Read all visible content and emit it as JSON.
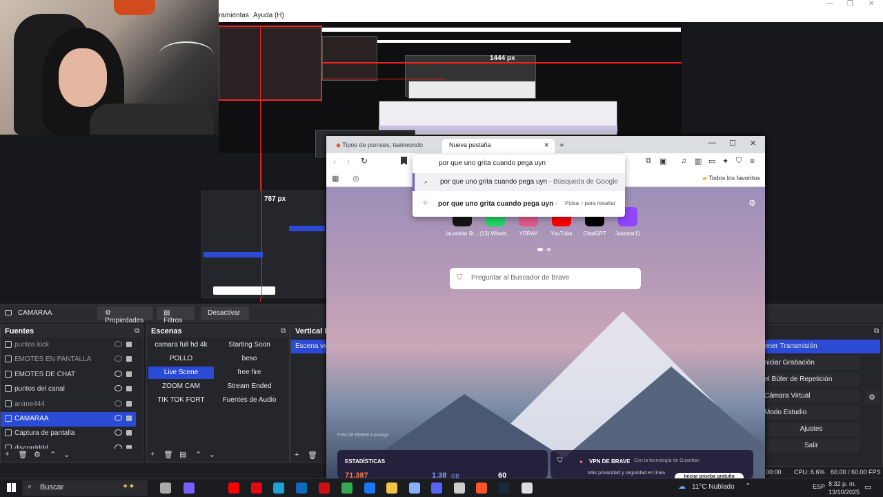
{
  "obs": {
    "menu": {
      "tools": "ramientas",
      "help": "Ayuda (H)"
    },
    "preview": {
      "label_1444": "1444 px",
      "label_787": "787 px"
    },
    "selected_source": "CAMARAA",
    "toolbar": {
      "properties": "Propiedades",
      "filters": "Filtros",
      "deactivate": "Desactivar"
    },
    "sources_title": "Fuentes",
    "sources": [
      {
        "label": "puntos kick",
        "dim": true
      },
      {
        "label": "EMOTES EN PANTALLA",
        "dim": true
      },
      {
        "label": "EMOTES DE CHAT",
        "dim": false
      },
      {
        "label": "puntos del canal",
        "dim": false
      },
      {
        "label": "anime444",
        "dim": true
      },
      {
        "label": "CAMARAA",
        "dim": false,
        "selected": true
      },
      {
        "label": "Captura de pantalla",
        "dim": false
      },
      {
        "label": "discordddd",
        "dim": false
      }
    ],
    "scenes_title": "Escenas",
    "scenes_left": [
      "camara full hd 4k",
      "POLLO",
      "Live Scene",
      "ZOOM CAM",
      "TIK TOK FORT"
    ],
    "scenes_right": [
      "Starting Soon",
      "beso",
      "free fire",
      "Stream Ended",
      "Fuentes de Audio"
    ],
    "vertical_title": "Vertical Es",
    "vertical_scene": "Escena vert",
    "controls": [
      "ener Transmisión",
      "niciar Grabación",
      "el Búfer de Repetición",
      "Cámara Virtual",
      "Modo Estudio",
      "Ajustes",
      "Salir"
    ],
    "status": {
      "time": "00:00",
      "cpu": "CPU: 6.6%",
      "fps": "60.00 / 60.00 FPS"
    }
  },
  "browser": {
    "tabs": [
      "Tipos de pumses, taekwondo",
      "Nueva pestaña"
    ],
    "omnibox_text": "por que uno grita cuando pega uyn",
    "suggestion_1": "por que uno grita cuando pega uyn",
    "suggestion_1_suffix": "- Búsqueda de Google",
    "suggestion_2": "por que uno grita cuando pega uyn",
    "suggestion_2_suffix": "-",
    "suggestion_2_hint": "Pulsa ↑ para resaltar",
    "bookmarks_folder": "Todos los favoritos",
    "tiles": [
      "lauratula St...",
      "(13) Whats...",
      "YDRAY",
      "YouTube",
      "ChatGPT",
      "Justmar11"
    ],
    "search_placeholder": "Preguntar al Buscador de Brave",
    "photo_credit": "Foto de Matein Lowaigo",
    "stats": {
      "title": "ESTADÍSTICAS",
      "value1": "71.387",
      "value2": "1.38",
      "unit2": "GB",
      "value3": "60"
    },
    "vpn": {
      "title": "VPN DE BRAVE",
      "powered": "Con la tecnología de Guardian",
      "desc": "Más privacidad y seguridad en línea",
      "cta": "Iniciar prueba gratuita"
    }
  },
  "taskbar": {
    "search": "Buscar",
    "weather": "11°C  Nublado",
    "lang": "ESP",
    "time": "8:32 p. m.",
    "date": "13/10/2025"
  }
}
